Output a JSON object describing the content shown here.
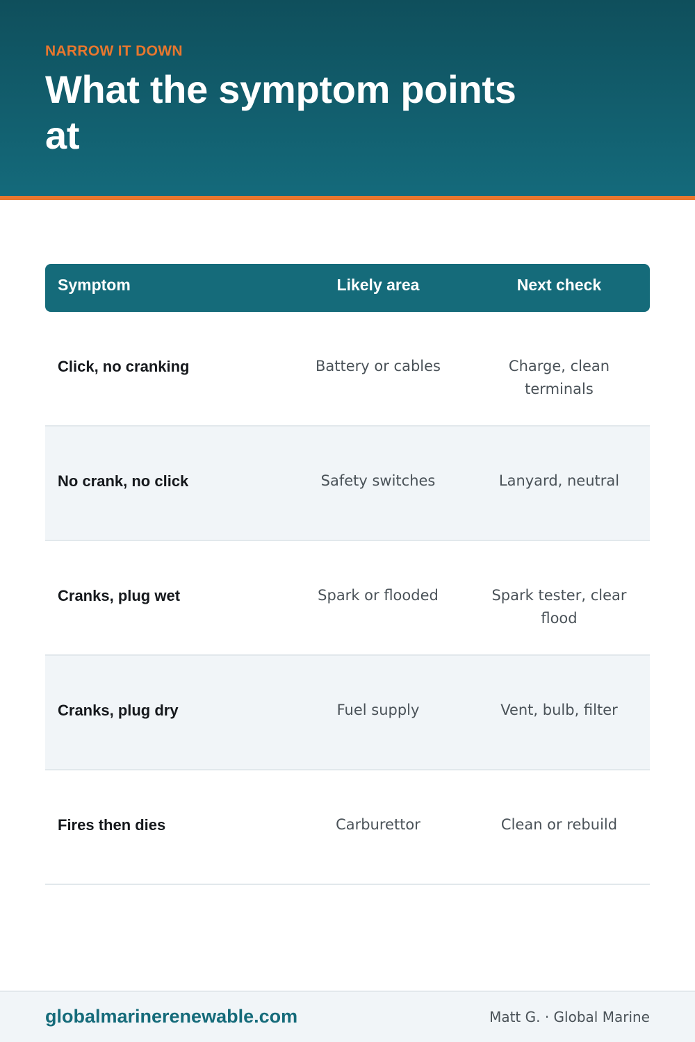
{
  "header": {
    "eyebrow": "NARROW IT DOWN",
    "title": "What the symptom points at"
  },
  "table": {
    "columns": [
      "Symptom",
      "Likely area",
      "Next check"
    ],
    "rows": [
      {
        "symptom": "Click, no cranking",
        "area": "Battery or cables",
        "check": "Charge, clean terminals"
      },
      {
        "symptom": "No crank, no click",
        "area": "Safety switches",
        "check": "Lanyard, neutral"
      },
      {
        "symptom": "Cranks, plug wet",
        "area": "Spark or flooded",
        "check": "Spark tester, clear flood"
      },
      {
        "symptom": "Cranks, plug dry",
        "area": "Fuel supply",
        "check": "Vent, bulb, filter"
      },
      {
        "symptom": "Fires then dies",
        "area": "Carburettor",
        "check": "Clean or rebuild"
      }
    ]
  },
  "footer": {
    "url": "globalmarinerenewable.com",
    "credit": "Matt G. · Global Marine"
  },
  "colors": {
    "header_dark": "#0f4f5c",
    "header_teal": "#146a7b",
    "accent_orange": "#e8772e",
    "table_header": "#156b7a",
    "row_alt": "#f1f5f8"
  }
}
